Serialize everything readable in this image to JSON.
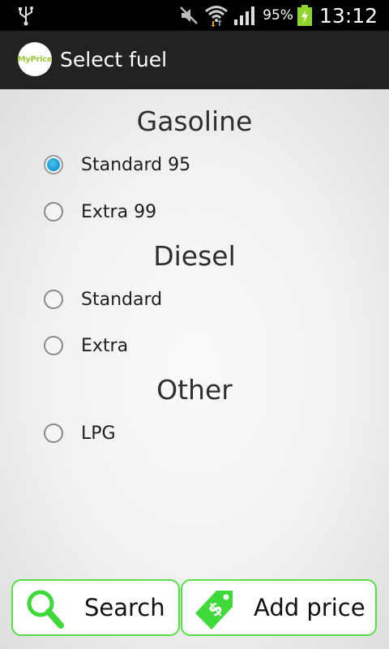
{
  "status_bar": {
    "battery_percent": "95%",
    "time": "13:12",
    "icons": [
      "usb-icon",
      "mute-icon",
      "wifi-icon",
      "signal-icon",
      "battery-charging-icon"
    ]
  },
  "action_bar": {
    "logo_text": "MyPrice",
    "title": "Select fuel"
  },
  "groups": [
    {
      "title": "Gasoline",
      "options": [
        {
          "label": "Standard 95",
          "checked": true
        },
        {
          "label": "Extra 99",
          "checked": false
        }
      ]
    },
    {
      "title": "Diesel",
      "options": [
        {
          "label": "Standard",
          "checked": false
        },
        {
          "label": "Extra",
          "checked": false
        }
      ]
    },
    {
      "title": "Other",
      "options": [
        {
          "label": "LPG",
          "checked": false
        }
      ]
    }
  ],
  "buttons": {
    "search_label": "Search",
    "add_price_label": "Add price"
  },
  "colors": {
    "accent_green": "#54e046",
    "radio_selected": "#0e97d1",
    "actionbar_bg": "#222222"
  }
}
